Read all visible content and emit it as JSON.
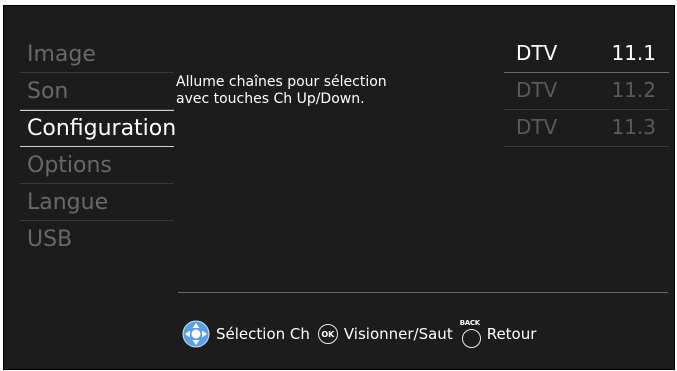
{
  "menu": {
    "items": [
      {
        "label": "Image",
        "selected": false
      },
      {
        "label": "Son",
        "selected": false
      },
      {
        "label": "Configuration",
        "selected": true
      },
      {
        "label": "Options",
        "selected": false
      },
      {
        "label": "Langue",
        "selected": false
      },
      {
        "label": "USB",
        "selected": false
      }
    ]
  },
  "description": {
    "line1": "Allume chaînes pour sélection",
    "line2": "avec touches Ch Up/Down."
  },
  "channels": [
    {
      "type": "DTV",
      "number": "11.1",
      "selected": true
    },
    {
      "type": "DTV",
      "number": "11.2",
      "selected": false
    },
    {
      "type": "DTV",
      "number": "11.3",
      "selected": false
    }
  ],
  "footer": {
    "select_label": "Sélection Ch",
    "ok_icon_text": "OK",
    "view_skip_label": "Visionner/Saut",
    "back_icon_text": "BACK",
    "return_label": "Retour"
  },
  "colors": {
    "background": "#1c1c1c",
    "selected_text": "#ffffff",
    "dim_text": "#686868",
    "dpad_blue": "#5aa0e6"
  },
  "icons": [
    "dpad-icon",
    "ok-button-icon",
    "back-button-icon"
  ]
}
